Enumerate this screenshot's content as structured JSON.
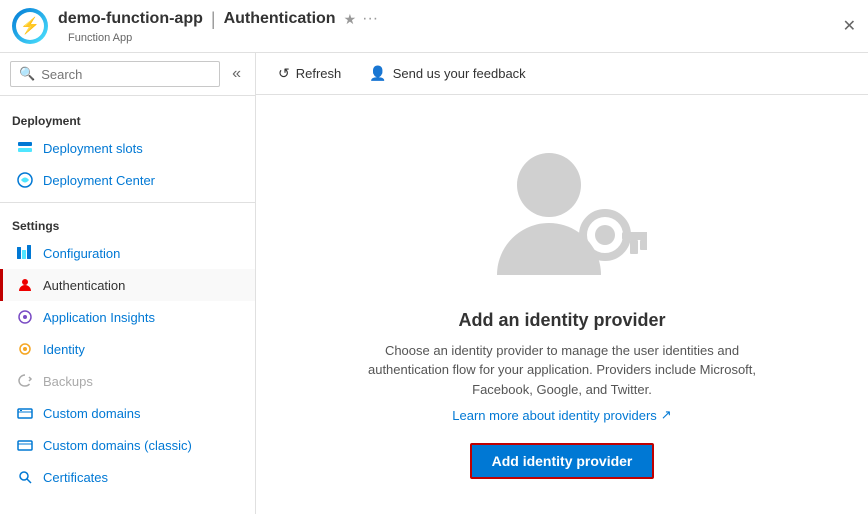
{
  "header": {
    "app_name": "demo-function-app",
    "separator": "|",
    "page_title": "Authentication",
    "sub_label": "Function App",
    "star_label": "★",
    "ellipsis_label": "···",
    "close_label": "✕"
  },
  "sidebar": {
    "search_placeholder": "Search",
    "collapse_icon": "«",
    "sections": [
      {
        "label": "Deployment",
        "items": [
          {
            "id": "deployment-slots",
            "label": "Deployment slots",
            "icon": "🟦",
            "active": false,
            "disabled": false
          },
          {
            "id": "deployment-center",
            "label": "Deployment Center",
            "icon": "🌐",
            "active": false,
            "disabled": false
          }
        ]
      },
      {
        "label": "Settings",
        "items": [
          {
            "id": "configuration",
            "label": "Configuration",
            "icon": "⚙",
            "active": false,
            "disabled": false
          },
          {
            "id": "authentication",
            "label": "Authentication",
            "icon": "👤",
            "active": true,
            "disabled": false
          },
          {
            "id": "application-insights",
            "label": "Application Insights",
            "icon": "💡",
            "active": false,
            "disabled": false
          },
          {
            "id": "identity",
            "label": "Identity",
            "icon": "🔑",
            "active": false,
            "disabled": false
          },
          {
            "id": "backups",
            "label": "Backups",
            "icon": "☁",
            "active": false,
            "disabled": true
          },
          {
            "id": "custom-domains",
            "label": "Custom domains",
            "icon": "🌐",
            "active": false,
            "disabled": false
          },
          {
            "id": "custom-domains-classic",
            "label": "Custom domains (classic)",
            "icon": "🌐",
            "active": false,
            "disabled": false
          },
          {
            "id": "certificates",
            "label": "Certificates",
            "icon": "🔒",
            "active": false,
            "disabled": false
          }
        ]
      }
    ]
  },
  "toolbar": {
    "refresh_label": "Refresh",
    "feedback_label": "Send us your feedback"
  },
  "content": {
    "illustration_alt": "Identity provider illustration",
    "add_title": "Add an identity provider",
    "add_description": "Choose an identity provider to manage the user identities and authentication flow for your application. Providers include Microsoft, Facebook, Google, and Twitter.",
    "learn_more_label": "Learn more about identity providers",
    "learn_more_icon": "↗",
    "add_button_label": "Add identity provider"
  }
}
